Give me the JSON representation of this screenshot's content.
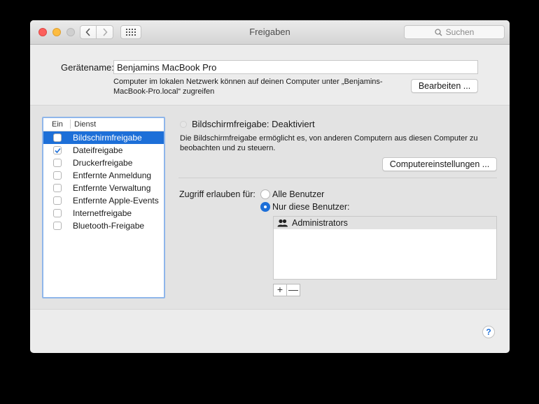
{
  "window": {
    "title": "Freigaben",
    "search_placeholder": "Suchen"
  },
  "device": {
    "name_label": "Gerätename:",
    "name_value": "Benjamins MacBook Pro",
    "description_line1": "Computer im lokalen Netzwerk können auf deinen Computer unter „Benjamins-",
    "description_line2": "MacBook-Pro.local“ zugreifen",
    "edit_button": "Bearbeiten ..."
  },
  "services": {
    "header_on": "Ein",
    "header_service": "Dienst",
    "items": [
      {
        "label": "Bildschirmfreigabe",
        "checked": false,
        "selected": true
      },
      {
        "label": "Dateifreigabe",
        "checked": true,
        "selected": false
      },
      {
        "label": "Druckerfreigabe",
        "checked": false,
        "selected": false
      },
      {
        "label": "Entfernte Anmeldung",
        "checked": false,
        "selected": false
      },
      {
        "label": "Entfernte Verwaltung",
        "checked": false,
        "selected": false
      },
      {
        "label": "Entfernte Apple-Events",
        "checked": false,
        "selected": false
      },
      {
        "label": "Internetfreigabe",
        "checked": false,
        "selected": false
      },
      {
        "label": "Bluetooth-Freigabe",
        "checked": false,
        "selected": false
      }
    ]
  },
  "detail": {
    "status_title": "Bildschirmfreigabe: Deaktiviert",
    "status_desc_line1": "Die Bildschirmfreigabe ermöglicht es, von anderen Computern aus diesen Computer zu",
    "status_desc_line2": "beobachten und zu steuern.",
    "computer_settings_button": "Computereinstellungen ...",
    "access_label": "Zugriff erlauben für:",
    "option_all": "Alle Benutzer",
    "option_only": "Nur diese Benutzer:",
    "selected_option": "only",
    "users": [
      "Administrators"
    ],
    "add_button": "+",
    "remove_button": "—"
  },
  "help_button": "?",
  "colors": {
    "accent": "#1d6fd8",
    "close": "#fc605c",
    "minimize": "#fdbc40",
    "zoom_disabled": "#cfcfcf"
  }
}
